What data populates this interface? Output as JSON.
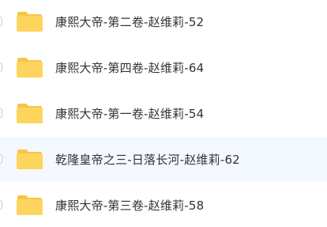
{
  "colors": {
    "folder_back": "#f7c544",
    "folder_front": "#fdd45e",
    "text": "#333333",
    "hover_bg": "#f4f8ff",
    "checkbox_border": "#c9ccd1"
  },
  "files": [
    {
      "name": "康熙大帝-第二卷-赵维莉-52",
      "icon": "folder-icon",
      "hovered": false
    },
    {
      "name": "康熙大帝-第四卷-赵维莉-64",
      "icon": "folder-icon",
      "hovered": false
    },
    {
      "name": "康熙大帝-第一卷-赵维莉-54",
      "icon": "folder-icon",
      "hovered": false
    },
    {
      "name": "乾隆皇帝之三-日落长河-赵维莉-62",
      "icon": "folder-icon",
      "hovered": true
    },
    {
      "name": "康熙大帝-第三卷-赵维莉-58",
      "icon": "folder-icon",
      "hovered": false
    }
  ]
}
